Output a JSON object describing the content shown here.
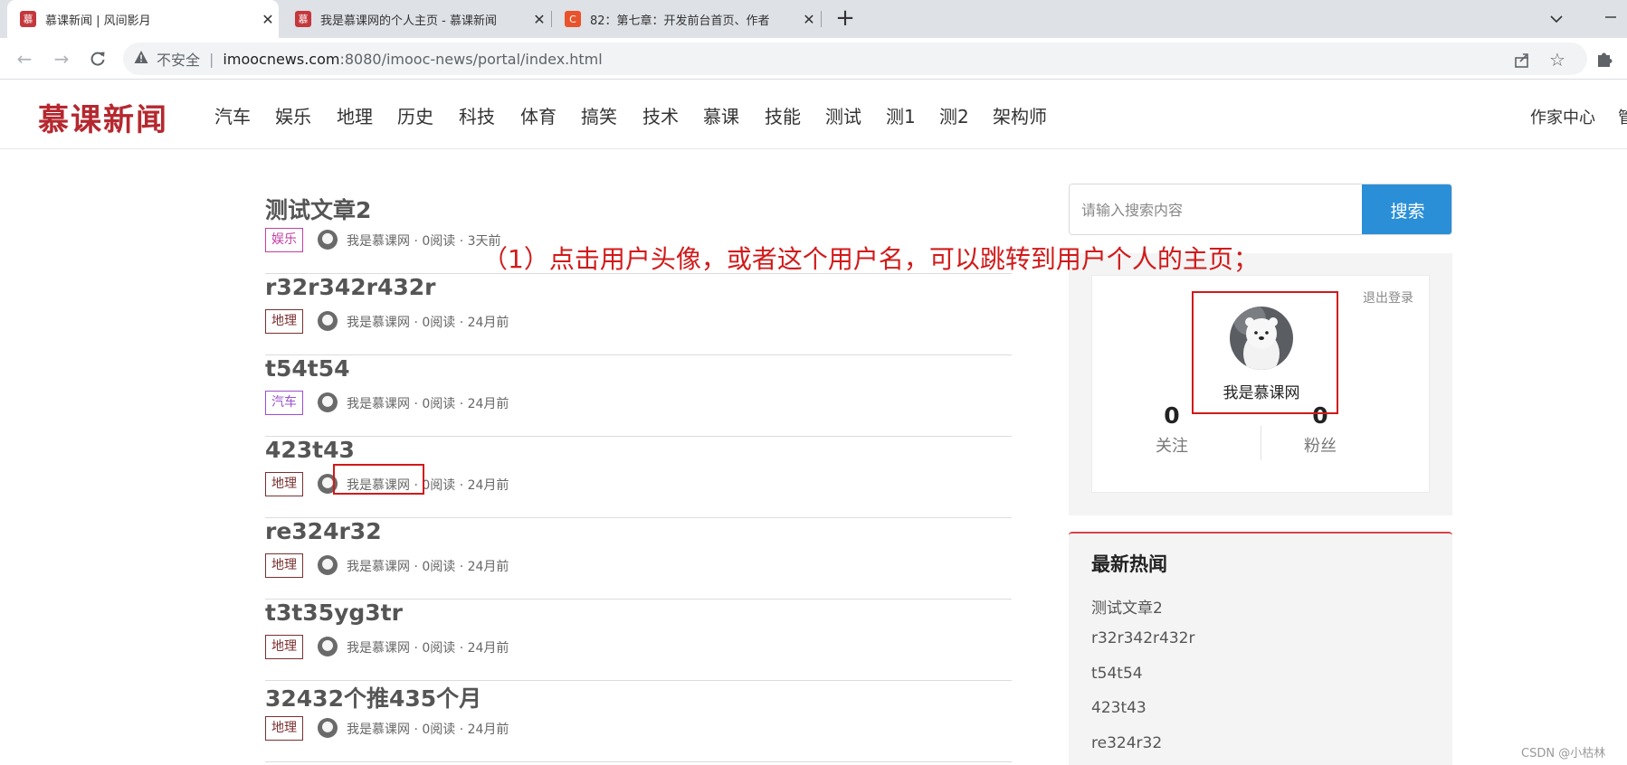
{
  "browser": {
    "tabs": [
      {
        "title": "慕课新闻 | 风间影月",
        "favicon": "慕",
        "favicon_color": "#c4373c",
        "active": true
      },
      {
        "title": "我是慕课网的个人主页 - 慕课新闻",
        "favicon": "慕",
        "favicon_color": "#c4373c",
        "active": false
      },
      {
        "title": "82：第七章：开发前台首页、作者",
        "favicon": "C",
        "favicon_color": "#e8532b",
        "active": false
      }
    ],
    "new_tab_icon": "plus-icon",
    "security_label": "不安全",
    "url_host": "imoocnews.com",
    "url_rest": ":8080/imooc-news/portal/index.html"
  },
  "site": {
    "logo": "慕课新闻",
    "nav": [
      "汽车",
      "娱乐",
      "地理",
      "历史",
      "科技",
      "体育",
      "搞笑",
      "技术",
      "慕课",
      "技能",
      "测试",
      "测1",
      "测2",
      "架构师"
    ],
    "author_center": "作家中心",
    "right_cut_text": "管"
  },
  "articles": [
    {
      "title": "测试文章2",
      "tag": "娱乐",
      "tag_color": "#c33fa5",
      "author": "我是慕课网",
      "meta": " · 0阅读 · 3天前"
    },
    {
      "title": "r32r342r432r",
      "tag": "地理",
      "tag_color": "#7a3030",
      "author": "我是慕课网",
      "meta": " · 0阅读 · 24月前"
    },
    {
      "title": "t54t54",
      "tag": "汽车",
      "tag_color": "#9b4fd0",
      "author": "我是慕课网",
      "meta": " · 0阅读 · 24月前"
    },
    {
      "title": "423t43",
      "tag": "地理",
      "tag_color": "#7a3030",
      "author": "我是慕课网",
      "meta": " · 0阅读 · 24月前"
    },
    {
      "title": "re324r32",
      "tag": "地理",
      "tag_color": "#7a3030",
      "author": "我是慕课网",
      "meta": " · 0阅读 · 24月前"
    },
    {
      "title": "t3t35yg3tr",
      "tag": "地理",
      "tag_color": "#7a3030",
      "author": "我是慕课网",
      "meta": " · 0阅读 · 24月前"
    },
    {
      "title": "32432个推435个月",
      "tag": "地理",
      "tag_color": "#7a3030",
      "author": "我是慕课网",
      "meta": " · 0阅读 · 24月前"
    }
  ],
  "search": {
    "placeholder": "请输入搜索内容",
    "button": "搜索"
  },
  "user": {
    "logout": "退出登录",
    "name": "我是慕课网",
    "follow_count": "0",
    "follow_label": "关注",
    "fans_count": "0",
    "fans_label": "粉丝"
  },
  "hot": {
    "title": "最新热闻",
    "items": [
      "测试文章2",
      "r32r342r432r",
      "t54t54",
      "423t43",
      "re324r32"
    ]
  },
  "annotation": "（1）点击用户头像，或者这个用户名，可以跳转到用户个人的主页；",
  "watermark": "CSDN @小枯林"
}
